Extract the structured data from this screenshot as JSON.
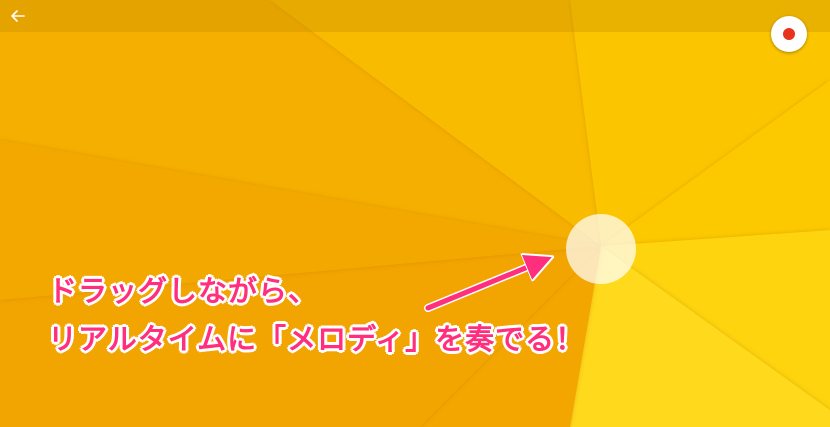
{
  "screen": {
    "caption_line1": "ドラッグしながら、",
    "caption_line2": "リアルタイムに「メロディ」を奏でる！"
  },
  "icons": {
    "back": "arrow-left-icon",
    "record": "record-icon"
  },
  "colors": {
    "background_base": "#f4a900",
    "background_light": "#ffd21c",
    "record_dot": "#e8321c",
    "caption_text": "#ff2f7d",
    "caption_outline": "#ffffff"
  }
}
